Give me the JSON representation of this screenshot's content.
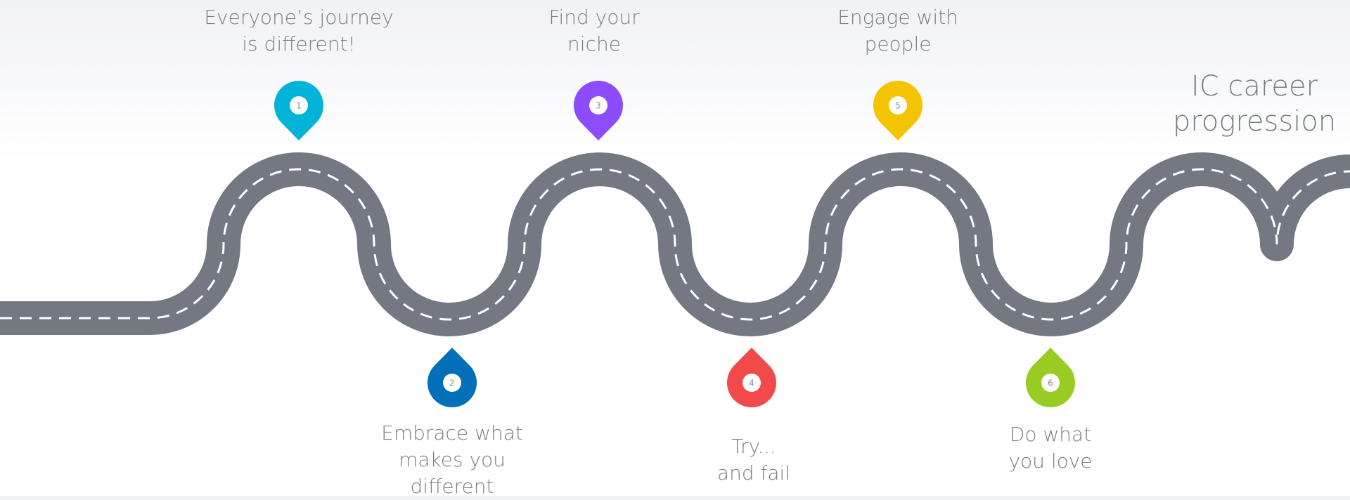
{
  "title": {
    "lines": [
      "IC career",
      "progression"
    ]
  },
  "milestones": [
    {
      "number": "1",
      "color": "#00b4d8",
      "lines": [
        "Everyone’s journey",
        "is different!"
      ]
    },
    {
      "number": "2",
      "color": "#0071b9",
      "lines": [
        "Embrace what",
        "makes you",
        "different"
      ]
    },
    {
      "number": "3",
      "color": "#8b4dff",
      "lines": [
        "Find your",
        "niche"
      ]
    },
    {
      "number": "4",
      "color": "#f24a4a",
      "lines": [
        "Try...",
        "and fail"
      ]
    },
    {
      "number": "5",
      "color": "#f5c400",
      "lines": [
        "Engage  with",
        "people"
      ]
    },
    {
      "number": "6",
      "color": "#99cc22",
      "lines": [
        "Do what",
        "you love"
      ]
    }
  ],
  "road": {
    "color": "#737883",
    "dash_color": "#ffffff"
  }
}
